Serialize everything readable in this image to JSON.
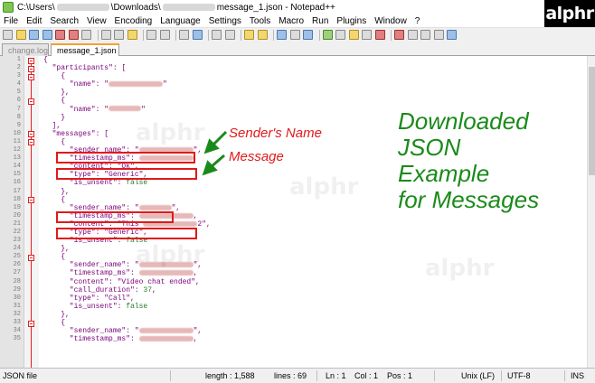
{
  "window": {
    "title_prefix": "C:\\Users\\",
    "title_mid": "\\Downloads\\",
    "title_suffix": "message_1.json - Notepad++"
  },
  "logo": {
    "text": "alphr"
  },
  "menu": [
    "File",
    "Edit",
    "Search",
    "View",
    "Encoding",
    "Language",
    "Settings",
    "Tools",
    "Macro",
    "Run",
    "Plugins",
    "Window",
    "?"
  ],
  "tabs": [
    {
      "label": "change.log",
      "active": false
    },
    {
      "label": "message_1.json",
      "active": true
    }
  ],
  "code_lines": [
    {
      "num": "1",
      "fold": true,
      "text": "{"
    },
    {
      "num": "2",
      "fold": true,
      "text": "  \"participants\": ["
    },
    {
      "num": "3",
      "fold": true,
      "text": "    {"
    },
    {
      "num": "4",
      "fold": false,
      "text": "      \"name\": \"",
      "blur": true,
      "tail": "\""
    },
    {
      "num": "5",
      "fold": false,
      "text": "    },"
    },
    {
      "num": "6",
      "fold": true,
      "text": "    {"
    },
    {
      "num": "7",
      "fold": false,
      "text": "      \"name\": \"",
      "blur": true,
      "blur_short": true,
      "tail": "\""
    },
    {
      "num": "8",
      "fold": false,
      "text": "    }"
    },
    {
      "num": "9",
      "fold": false,
      "text": "  ],"
    },
    {
      "num": "10",
      "fold": true,
      "text": "  \"messages\": ["
    },
    {
      "num": "11",
      "fold": true,
      "text": "    {"
    },
    {
      "num": "12",
      "fold": false,
      "text": "      \"sender_name\": \"",
      "blur": true,
      "tail": "\","
    },
    {
      "num": "13",
      "fold": false,
      "text": "      \"timestamp_ms\": ",
      "blur": true,
      "tail": ","
    },
    {
      "num": "14",
      "fold": false,
      "text": "      \"content\": \"Ok\","
    },
    {
      "num": "15",
      "fold": false,
      "text": "      \"type\": \"Generic\","
    },
    {
      "num": "16",
      "fold": false,
      "text": "      \"is_unsent\": ",
      "num_val": "false"
    },
    {
      "num": "17",
      "fold": false,
      "text": "    },"
    },
    {
      "num": "18",
      "fold": true,
      "text": "    {"
    },
    {
      "num": "19",
      "fold": false,
      "text": "      \"sender_name\": \"",
      "blur": true,
      "blur_short": true,
      "tail": "\","
    },
    {
      "num": "20",
      "fold": false,
      "text": "      \"timestamp_ms\": ",
      "blur": true,
      "tail": ","
    },
    {
      "num": "21",
      "fold": false,
      "text": "      \"content\": \"This ",
      "blur": true,
      "tail": "2\","
    },
    {
      "num": "22",
      "fold": false,
      "text": "      \"type\": \"Generic\","
    },
    {
      "num": "23",
      "fold": false,
      "text": "      \"is_unsent\": ",
      "num_val": "false"
    },
    {
      "num": "24",
      "fold": false,
      "text": "    },"
    },
    {
      "num": "25",
      "fold": true,
      "text": "    {"
    },
    {
      "num": "26",
      "fold": false,
      "text": "      \"sender_name\": \"",
      "blur": true,
      "tail": "\","
    },
    {
      "num": "27",
      "fold": false,
      "text": "      \"timestamp_ms\": ",
      "blur": true,
      "tail": ","
    },
    {
      "num": "28",
      "fold": false,
      "text": "      \"content\": \"Video chat ended\","
    },
    {
      "num": "29",
      "fold": false,
      "text": "      \"call_duration\": ",
      "num_val": "37",
      "tail": ","
    },
    {
      "num": "30",
      "fold": false,
      "text": "      \"type\": \"Call\","
    },
    {
      "num": "31",
      "fold": false,
      "text": "      \"is_unsent\": ",
      "num_val": "false"
    },
    {
      "num": "32",
      "fold": false,
      "text": "    },"
    },
    {
      "num": "33",
      "fold": true,
      "text": "    {"
    },
    {
      "num": "34",
      "fold": false,
      "text": "      \"sender_name\": \"",
      "blur": true,
      "tail": "\","
    },
    {
      "num": "35",
      "fold": false,
      "text": "      \"timestamp_ms\": ",
      "blur": true,
      "tail": ","
    }
  ],
  "annotations": {
    "sender_label": "Sender's Name",
    "message_label": "Message",
    "big_note": [
      "Downloaded",
      "JSON",
      "Example",
      "for Messages"
    ]
  },
  "status": {
    "file_type": "JSON file",
    "length": "length : 1,588",
    "lines": "lines : 69",
    "ln": "Ln : 1",
    "col": "Col : 1",
    "pos": "Pos : 1",
    "eol": "Unix (LF)",
    "encoding": "UTF-8",
    "mode": "INS"
  },
  "colors": {
    "annotation_red": "#e01a1a",
    "note_green": "#1a8a1a",
    "fold_red": "#e02020"
  }
}
